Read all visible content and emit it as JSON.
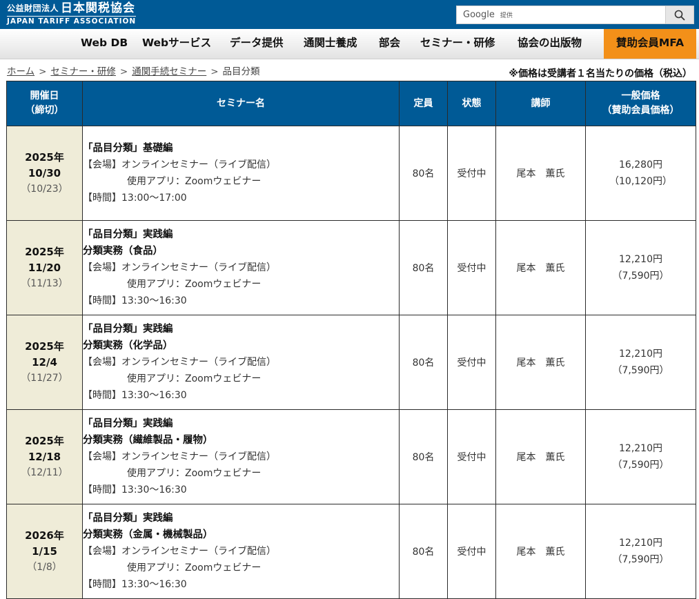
{
  "header": {
    "logo_small": "公益財団法人",
    "logo_big": "日本関税協会",
    "logo_en": "JAPAN TARIFF ASSOCIATION",
    "search_brand": "Google",
    "search_provided": "提供"
  },
  "nav": {
    "items": [
      "Web DB",
      "Webサービス",
      "データ提供",
      "通関士養成",
      "部会",
      "セミナー・研修",
      "協会の出版物"
    ],
    "mfa": "賛助会員MFA"
  },
  "breadcrumb": {
    "items": [
      "ホーム",
      "セミナー・研修",
      "通関手続セミナー"
    ],
    "current": "品目分類",
    "separator": ">"
  },
  "note": "※価格は受講者１名当たりの価格（税込）",
  "table": {
    "headers": {
      "date_line1": "開催日",
      "date_line2": "（締切）",
      "name": "セミナー名",
      "capacity": "定員",
      "status": "状態",
      "instructor": "講師",
      "price_line1": "一般価格",
      "price_line2": "（賛助会員価格）"
    },
    "rows": [
      {
        "year": "2025年",
        "md": "10/30",
        "deadline": "（10/23）",
        "title1": "「品目分類」基礎編",
        "title2": "",
        "venue": "【会場】オンラインセミナー（ライブ配信）",
        "app": "使用アプリ：Zoomウェビナー",
        "time": "【時間】13:00〜17:00",
        "capacity": "80名",
        "status": "受付中",
        "instructor": "尾本　薫氏",
        "price": "16,280円",
        "member_price": "（10,120円）"
      },
      {
        "year": "2025年",
        "md": "11/20",
        "deadline": "（11/13）",
        "title1": "「品目分類」実践編",
        "title2": "分類実務（食品）",
        "venue": "【会場】オンラインセミナー（ライブ配信）",
        "app": "使用アプリ：Zoomウェビナー",
        "time": "【時間】13:30〜16:30",
        "capacity": "80名",
        "status": "受付中",
        "instructor": "尾本　薫氏",
        "price": "12,210円",
        "member_price": "（7,590円）"
      },
      {
        "year": "2025年",
        "md": "12/4",
        "deadline": "（11/27）",
        "title1": "「品目分類」実践編",
        "title2": "分類実務（化学品）",
        "venue": "【会場】オンラインセミナー（ライブ配信）",
        "app": "使用アプリ：Zoomウェビナー",
        "time": "【時間】13:30〜16:30",
        "capacity": "80名",
        "status": "受付中",
        "instructor": "尾本　薫氏",
        "price": "12,210円",
        "member_price": "（7,590円）"
      },
      {
        "year": "2025年",
        "md": "12/18",
        "deadline": "（12/11）",
        "title1": "「品目分類」実践編",
        "title2": "分類実務（繊維製品・履物）",
        "venue": "【会場】オンラインセミナー（ライブ配信）",
        "app": "使用アプリ：Zoomウェビナー",
        "time": "【時間】13:30〜16:30",
        "capacity": "80名",
        "status": "受付中",
        "instructor": "尾本　薫氏",
        "price": "12,210円",
        "member_price": "（7,590円）"
      },
      {
        "year": "2026年",
        "md": "1/15",
        "deadline": "（1/8）",
        "title1": "「品目分類」実践編",
        "title2": "分類実務（金属・機械製品）",
        "venue": "【会場】オンラインセミナー（ライブ配信）",
        "app": "使用アプリ：Zoomウェビナー",
        "time": "【時間】13:30〜16:30",
        "capacity": "80名",
        "status": "受付中",
        "instructor": "尾本　薫氏",
        "price": "12,210円",
        "member_price": "（7,590円）"
      }
    ]
  }
}
